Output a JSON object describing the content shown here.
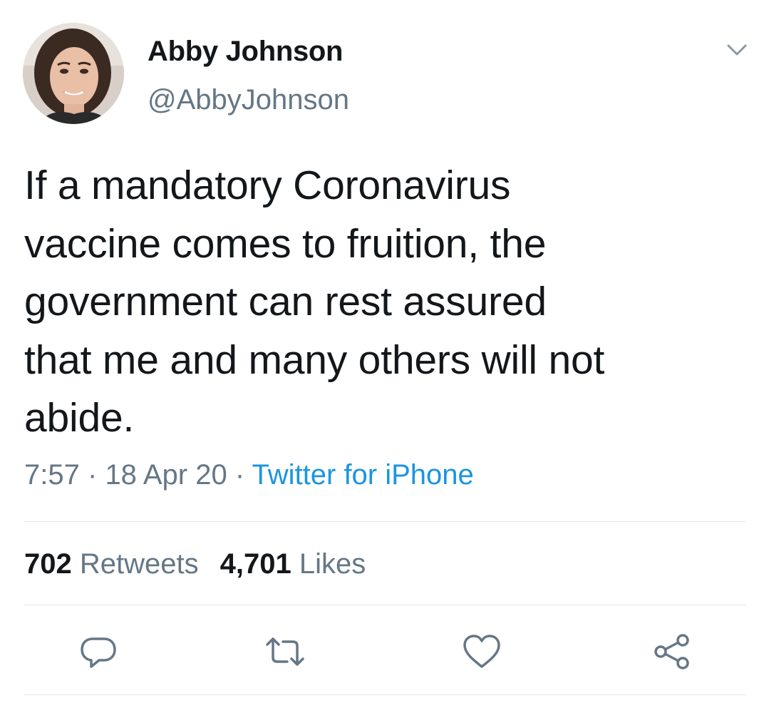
{
  "author": {
    "display_name": "Abby Johnson",
    "handle": "@AbbyJohnson"
  },
  "tweet": {
    "text": "If a mandatory Coronavirus\nvaccine comes to fruition, the\ngovernment can rest assured\nthat me and many others will not\nabide.",
    "time": "7:57",
    "date": "18 Apr 20",
    "separator": "·",
    "source": "Twitter for iPhone"
  },
  "stats": {
    "retweets_count": "702",
    "retweets_label": "Retweets",
    "likes_count": "4,701",
    "likes_label": "Likes"
  },
  "actions": [
    {
      "icon": "reply-icon"
    },
    {
      "icon": "retweet-icon"
    },
    {
      "icon": "like-heart-icon"
    },
    {
      "icon": "share-icon"
    }
  ],
  "colors": {
    "text_primary": "#14171a",
    "text_secondary": "#657786",
    "link": "#1b95e0",
    "divider": "#e1e8ed",
    "icon": "#657786"
  }
}
